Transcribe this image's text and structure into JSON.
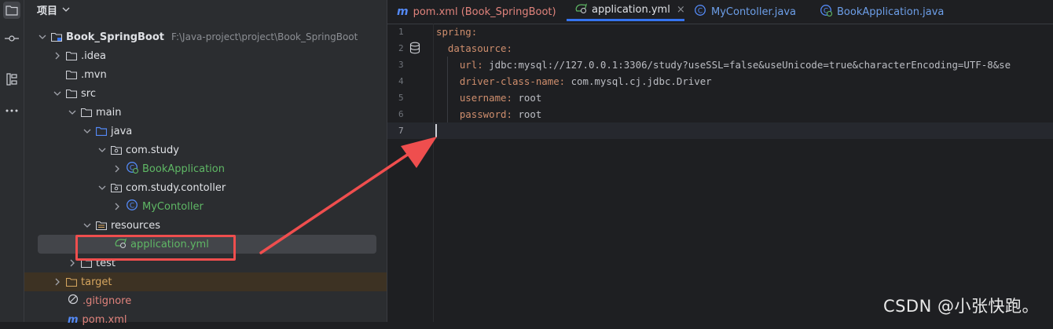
{
  "activity_bar": {
    "icons": [
      "folder-icon",
      "commit-icon",
      "structure-icon",
      "more-icon"
    ]
  },
  "project_panel": {
    "title": "项目",
    "tree": [
      {
        "name": "Book_SpringBoot",
        "path": "F:\\Java-project\\project\\Book_SpringBoot",
        "type": "module-folder",
        "expanded": true
      },
      {
        "name": ".idea",
        "type": "folder",
        "expanded": false
      },
      {
        "name": ".mvn",
        "type": "folder",
        "expanded": false
      },
      {
        "name": "src",
        "type": "folder",
        "expanded": true
      },
      {
        "name": "main",
        "type": "folder",
        "expanded": true
      },
      {
        "name": "java",
        "type": "source-folder",
        "expanded": true
      },
      {
        "name": "com.study",
        "type": "package",
        "expanded": true
      },
      {
        "name": "BookApplication",
        "type": "spring-class",
        "expanded": false
      },
      {
        "name": "com.study.contoller",
        "type": "package",
        "expanded": true
      },
      {
        "name": "MyContoller",
        "type": "class",
        "expanded": false
      },
      {
        "name": "resources",
        "type": "resource-folder",
        "expanded": true
      },
      {
        "name": "application.yml",
        "type": "yml-file",
        "selected": true
      },
      {
        "name": "test",
        "type": "folder",
        "expanded": false
      },
      {
        "name": "target",
        "type": "excluded-folder",
        "expanded": false
      },
      {
        "name": ".gitignore",
        "type": "gitignore-file"
      },
      {
        "name": "pom.xml",
        "type": "maven-file"
      }
    ]
  },
  "editor": {
    "tabs": [
      {
        "label": "pom.xml (Book_SpringBoot)",
        "icon": "maven-icon",
        "active": false
      },
      {
        "label": "application.yml",
        "icon": "yml-icon",
        "active": true,
        "closable": true
      },
      {
        "label": "MyContoller.java",
        "icon": "class-icon",
        "active": false
      },
      {
        "label": "BookApplication.java",
        "icon": "spring-class-icon",
        "active": false
      }
    ],
    "close_glyph": "×",
    "line_numbers": [
      "1",
      "2",
      "3",
      "4",
      "5",
      "6",
      "7"
    ],
    "current_line": "7",
    "lines": [
      {
        "key": "spring:",
        "value": ""
      },
      {
        "key": "  datasource:",
        "value": ""
      },
      {
        "key": "    url:",
        "value": " jdbc:mysql://127.0.0.1:3306/study?useSSL=false&useUnicode=true&characterEncoding=UTF-8&se"
      },
      {
        "key": "    driver-class-name:",
        "value": " com.mysql.cj.jdbc.Driver"
      },
      {
        "key": "    username:",
        "value": " root"
      },
      {
        "key": "    password:",
        "value": " root"
      },
      {
        "key": "",
        "value": ""
      }
    ]
  },
  "watermark": "CSDN @小张快跑。",
  "colors": {
    "annotation": "#ef4e4e",
    "accent": "#3574f0",
    "yaml_key": "#cf8e6d",
    "spring_green": "#5fb865"
  }
}
